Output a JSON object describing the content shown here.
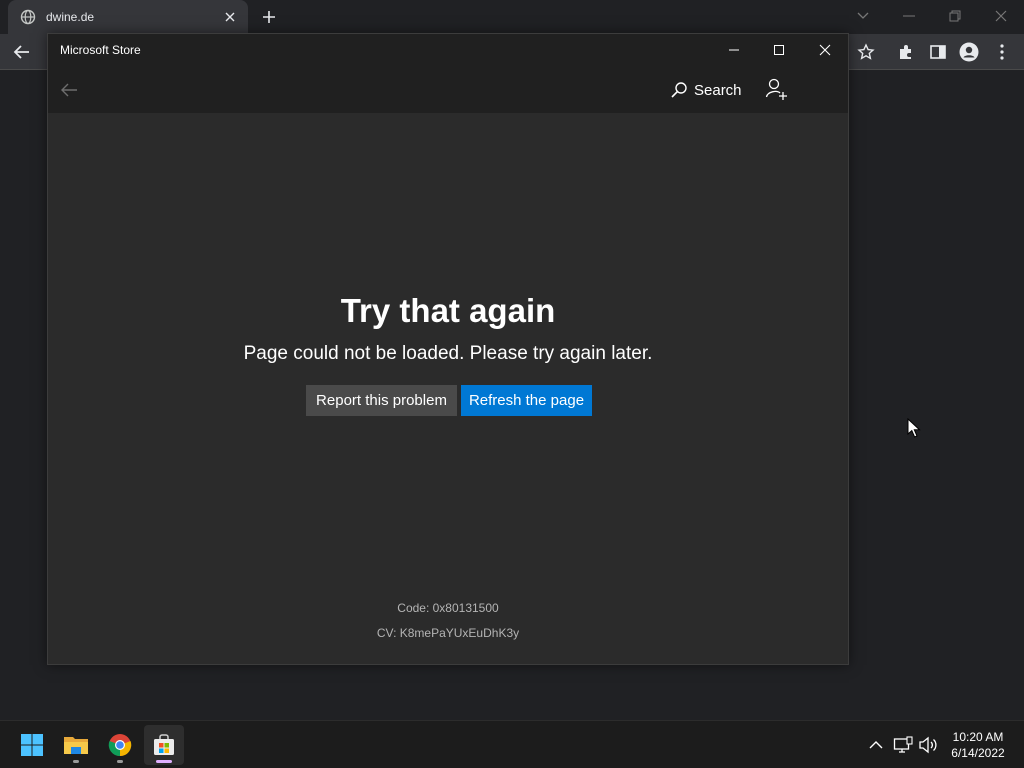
{
  "browser": {
    "tab_title": "dwine.de"
  },
  "store_window": {
    "title": "Microsoft Store",
    "nav": {
      "search_label": "Search"
    },
    "error": {
      "title": "Try that again",
      "message": "Page could not be loaded. Please try again later.",
      "report_button": "Report this problem",
      "refresh_button": "Refresh the page",
      "code": "Code: 0x80131500",
      "cv": "CV: K8mePaYUxEuDhK3y"
    },
    "accent_color": "#0078d4"
  },
  "taskbar": {
    "apps": [
      "windows-start",
      "file-explorer",
      "google-chrome",
      "microsoft-store"
    ],
    "clock_time": "10:20 AM",
    "clock_date": "6/14/2022"
  }
}
